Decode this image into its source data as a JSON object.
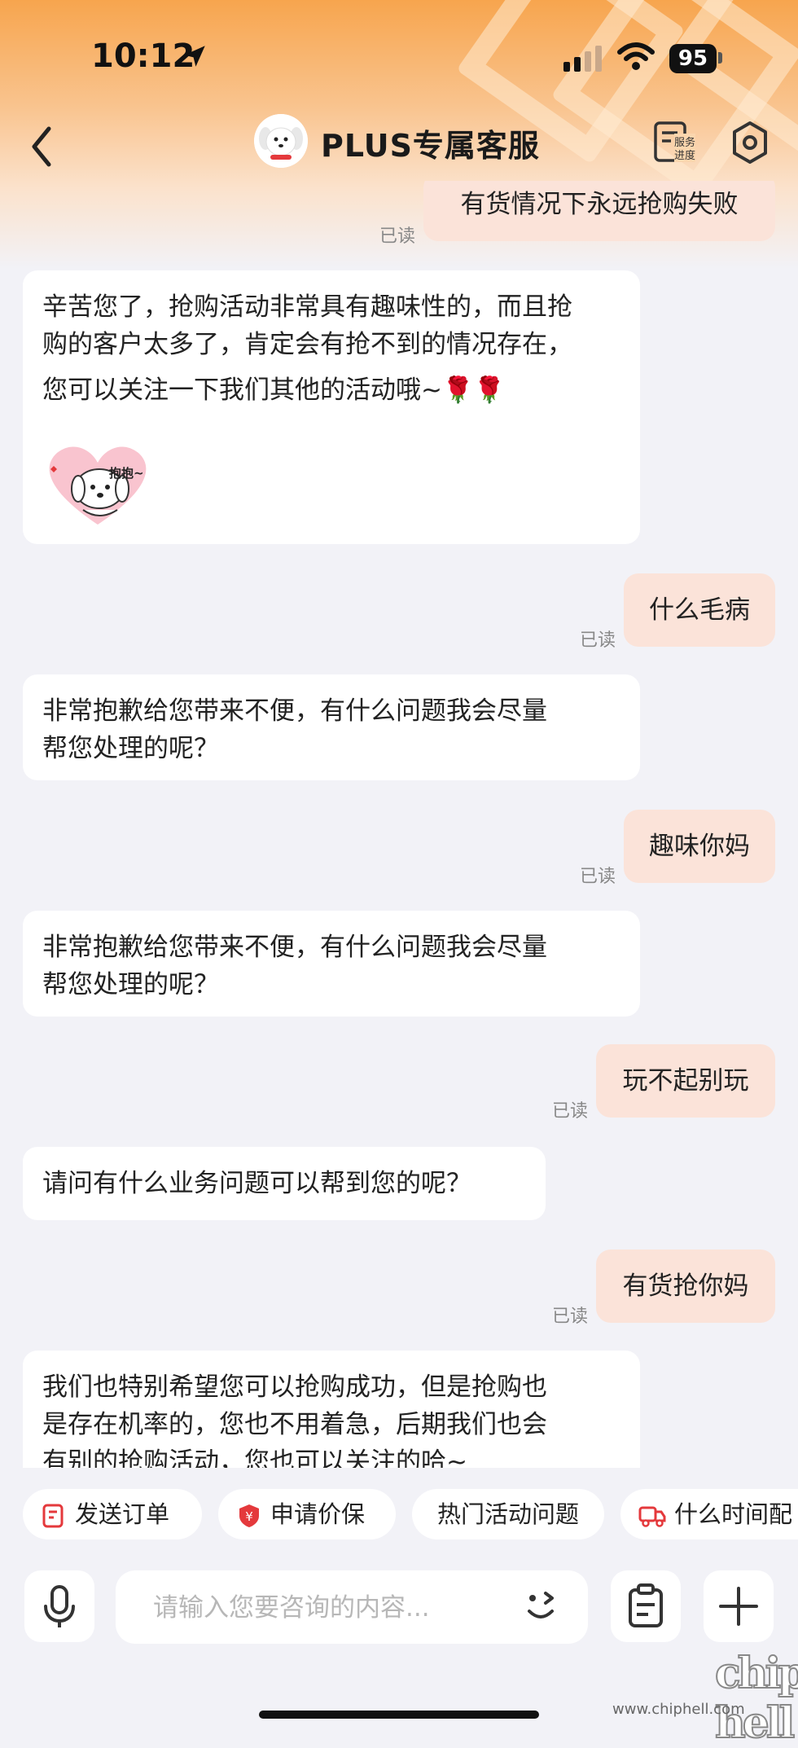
{
  "status": {
    "time": "10:12",
    "battery": "95"
  },
  "header": {
    "title": "PLUS专属客服",
    "service_btn_line1": "服务",
    "service_btn_line2": "进度"
  },
  "messages": {
    "m0": {
      "text": "有货情况下永远抢购失败",
      "read": "已读"
    },
    "m1": {
      "line1": "辛苦您了，抢购活动非常具有趣味性的，而且抢",
      "line2": "购的客户太多了，肯定会有抢不到的情况存在，",
      "line3": "您可以关注一下我们其他的活动哦~🌹🌹",
      "sticker": "抱抱~"
    },
    "m2": {
      "text": "什么毛病",
      "read": "已读"
    },
    "m3": {
      "line1": "非常抱歉给您带来不便，有什么问题我会尽量",
      "line2": "帮您处理的呢？"
    },
    "m4": {
      "text": "趣味你妈",
      "read": "已读"
    },
    "m5": {
      "line1": "非常抱歉给您带来不便，有什么问题我会尽量",
      "line2": "帮您处理的呢？"
    },
    "m6": {
      "text": "玩不起别玩",
      "read": "已读"
    },
    "m7": {
      "text": "请问有什么业务问题可以帮到您的呢？"
    },
    "m8": {
      "text": "有货抢你妈",
      "read": "已读"
    },
    "m9": {
      "line1": "我们也特别希望您可以抢购成功，但是抢购也",
      "line2": "是存在机率的，您也不用着急，后期我们也会",
      "line3": "有别的抢购活动，您也可以关注的哈~"
    }
  },
  "quick_actions": [
    "发送订单",
    "申请价保",
    "热门活动问题",
    "什么时间配"
  ],
  "input": {
    "placeholder": "请输入您要咨询的内容..."
  },
  "watermark": {
    "url": "www.chiphell.com",
    "logo": "chip hell"
  },
  "colors": {
    "accent": "#e4393c",
    "user_bubble": "#fbe3d9",
    "header_orange": "#f7a54e"
  }
}
